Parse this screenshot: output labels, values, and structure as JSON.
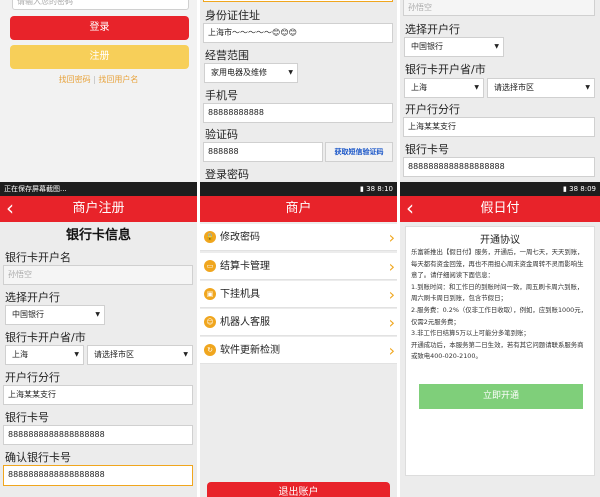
{
  "status": {
    "left_notice": "正在保存屏幕截图...",
    "time_a": "8:10",
    "time_b": "8:09",
    "battery": "38"
  },
  "login": {
    "password_placeholder": "请输入您的密码",
    "login_button": "登录",
    "register_button": "注册",
    "find_password": "找回密码",
    "separator": "|",
    "find_username": "找回用户名"
  },
  "register_top": {
    "id_address_label": "身份证住址",
    "id_address_value": "上海市～～～～～😊😊😊",
    "scope_label": "经营范围",
    "scope_value": "家用电器及维修",
    "phone_label": "手机号",
    "phone_value": "88888888888",
    "code_label": "验证码",
    "code_value": "888888",
    "code_button": "获取短信验证码",
    "login_password_label": "登录密码"
  },
  "bank_top": {
    "name_value": "孙悟空",
    "bank_label": "选择开户行",
    "bank_value": "中国银行",
    "province_label": "银行卡开户省/市",
    "province_value": "上海",
    "city_value": "请选择市区",
    "branch_label": "开户行分行",
    "branch_value": "上海某某支行",
    "card_label": "银行卡号",
    "card_value": "8888888888888888888"
  },
  "merchant_register": {
    "header": "商户注册",
    "title": "银行卡信息",
    "name_label": "银行卡开户名",
    "name_placeholder": "孙悟空",
    "bank_label": "选择开户行",
    "bank_value": "中国银行",
    "province_label": "银行卡开户省/市",
    "province_value": "上海",
    "city_value": "请选择市区",
    "branch_label": "开户行分行",
    "branch_value": "上海某某支行",
    "card_label": "银行卡号",
    "card_value": "8888888888888888888",
    "confirm_label": "确认银行卡号",
    "confirm_value": "8888888888888888888"
  },
  "merchant": {
    "header": "商户",
    "items": [
      {
        "label": "修改密码",
        "icon": "lock-icon"
      },
      {
        "label": "结算卡管理",
        "icon": "card-icon"
      },
      {
        "label": "下挂机具",
        "icon": "device-icon"
      },
      {
        "label": "机器人客服",
        "icon": "robot-icon"
      },
      {
        "label": "软件更新检测",
        "icon": "update-icon"
      }
    ],
    "logout": "退出账户"
  },
  "jiarifu": {
    "header": "假日付",
    "agreement_title": "开通协议",
    "p1": "乐富新推出【假日付】服务，开通后，一周七天，天天到账，每天都有资金回笼，再也不用担心周末资金周转不灵而影响生意了。请仔细阅读下面信息：",
    "p2": "1.到账时间：和工作日的到账时间一致，周五刷卡周六到账，周六刷卡周日到账，包含节假日；",
    "p3": "2.服务费：0.2%（仅非工作日收取），例如，应到账1000元，仅需2元服务费；",
    "p4": "3.非工作日结算5万以上可能分多笔到账；",
    "p5": "开通成功后，本服务第二日生效，若有其它问题请联系服务商或致电400-020-2100。",
    "open_button": "立即开通"
  }
}
